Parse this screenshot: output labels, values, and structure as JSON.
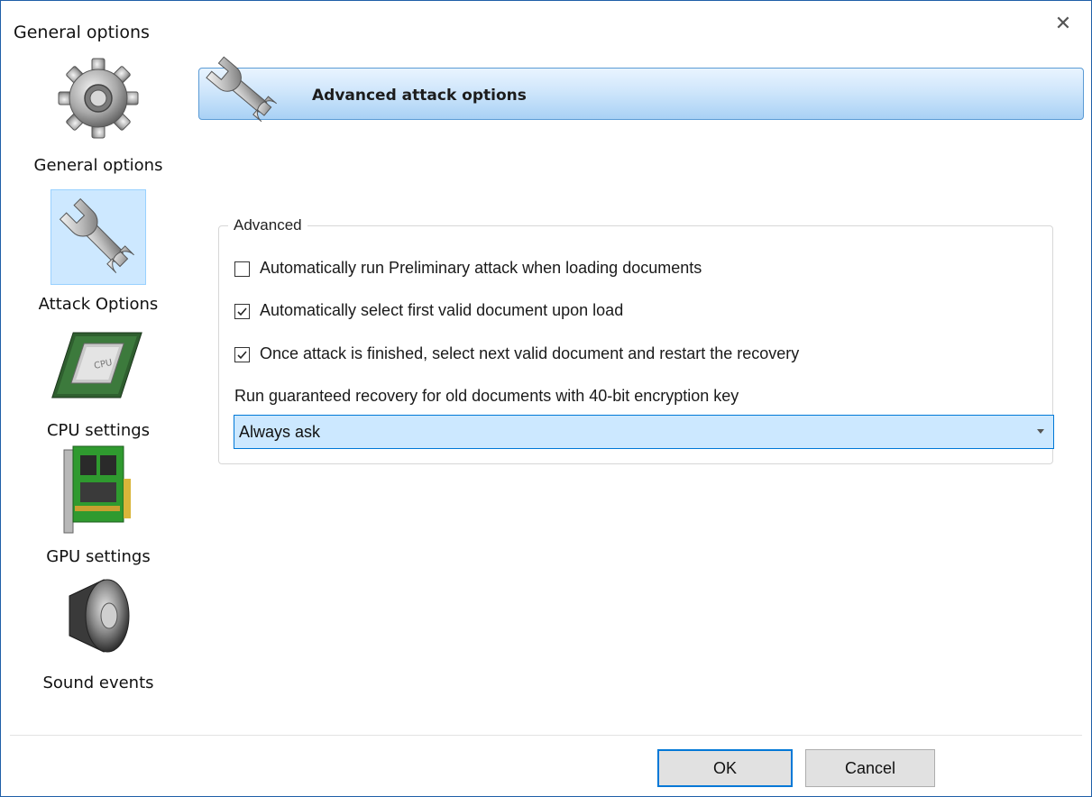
{
  "window": {
    "title": "General options",
    "close_glyph": "✕"
  },
  "sidebar": {
    "items": [
      {
        "label": "General options",
        "icon": "gear-icon",
        "selected": false
      },
      {
        "label": "Attack Options",
        "icon": "wrench-icon",
        "selected": true
      },
      {
        "label": "CPU settings",
        "icon": "cpu-chip-icon",
        "selected": false
      },
      {
        "label": "GPU settings",
        "icon": "gpu-card-icon",
        "selected": false
      },
      {
        "label": "Sound events",
        "icon": "speaker-icon",
        "selected": false
      }
    ]
  },
  "header": {
    "title": "Advanced attack options",
    "icon": "wrench-icon"
  },
  "advanced": {
    "group_label": "Advanced",
    "checkboxes": [
      {
        "label": "Automatically run Preliminary attack when loading documents",
        "checked": false
      },
      {
        "label": "Automatically select first valid document upon load",
        "checked": true
      },
      {
        "label": "Once attack is finished, select next valid document and restart the recovery",
        "checked": true
      }
    ],
    "recovery_label": "Run guaranteed recovery for old documents with 40-bit encryption key",
    "recovery_select": {
      "value": "Always ask"
    }
  },
  "footer": {
    "ok_label": "OK",
    "cancel_label": "Cancel"
  }
}
